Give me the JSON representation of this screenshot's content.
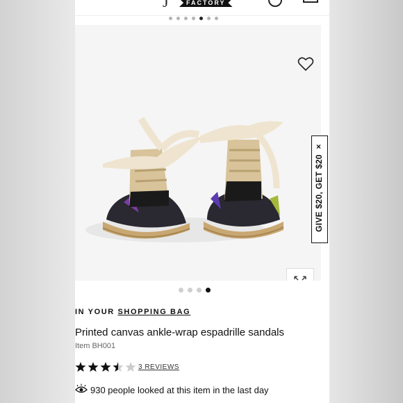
{
  "header": {
    "logo_letter": "J",
    "brand_badge": "FACTORY"
  },
  "thumbnails": {
    "count": 7,
    "active_index": 4
  },
  "gallery": {
    "pager_count": 4,
    "active_index": 3
  },
  "promo": {
    "text": "GIVE $20, GET $20",
    "close": "×"
  },
  "bag": {
    "prefix": "IN YOUR",
    "link": "SHOPPING BAG"
  },
  "product": {
    "title": "Printed canvas ankle-wrap espadrille sandals",
    "item": "Item BH001",
    "rating": 3.5,
    "reviews_link": "3 REVIEWS",
    "views_text": "930 people looked at this item in the last day"
  },
  "icons": [
    "heart-icon",
    "expand-icon",
    "close-icon",
    "eye-icon",
    "star-icon",
    "account-icon",
    "bag-icon"
  ],
  "colors": {
    "text": "#111111",
    "muted": "#666666",
    "image_bg": "#f3f3f3"
  }
}
